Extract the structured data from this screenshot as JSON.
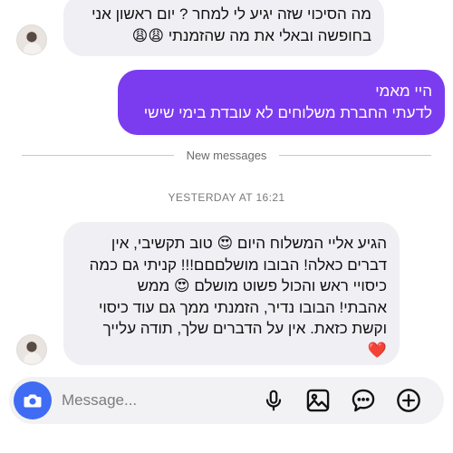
{
  "thread": {
    "messages": [
      {
        "direction": "incoming",
        "lines": [
          "מה הסיכוי שזה יגיע לי למחר ? יום ראשון אני",
          "בחופשה ובאלי את מה שהזמנתי 😩😩"
        ]
      },
      {
        "direction": "outgoing",
        "lines": [
          "היי מאמי",
          "לדעתי החברת משלוחים לא עובדת בימי שישי"
        ]
      },
      {
        "direction": "incoming",
        "lines": [
          "הגיע אליי המשלוח היום 😍 טוב תקשיבי, אין",
          "דברים כאלה! הבובו מושלםםם!!! קניתי גם כמה",
          "כיסויי ראש והכול פשוט מושלם 😍 ממש",
          "אהבתי! הבובו נדיר, הזמנתי ממך גם עוד כיסוי",
          "וקשת כזאת. אין על הדברים שלך, תודה עלייך",
          "❤️"
        ]
      }
    ],
    "new_messages_label": "New messages",
    "timestamp": "YESTERDAY AT 16:21"
  },
  "composer": {
    "placeholder": "Message...",
    "value": "",
    "accent_color": "#3f6cf3",
    "icons": [
      "camera-icon",
      "microphone-icon",
      "image-icon",
      "sticker-icon",
      "add-icon"
    ]
  },
  "colors": {
    "incoming_bubble": "#efeff4",
    "outgoing_bubble": "#7b3cf0"
  }
}
